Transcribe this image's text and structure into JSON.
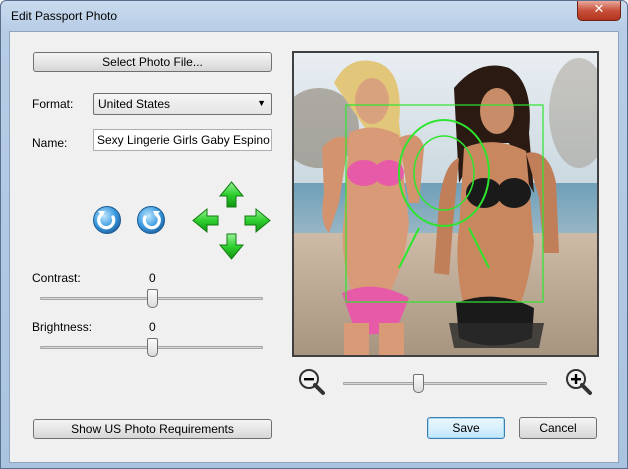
{
  "window": {
    "title": "Edit Passport Photo",
    "close_glyph": "✕"
  },
  "buttons": {
    "select_photo": "Select Photo File...",
    "show_requirements": "Show US Photo Requirements",
    "save": "Save",
    "cancel": "Cancel"
  },
  "format": {
    "label": "Format:",
    "value": "United States"
  },
  "name": {
    "label": "Name:",
    "value": "Sexy Lingerie Girls Gaby Espino &"
  },
  "icons": {
    "rotate_left": "rotate-left-icon",
    "rotate_right": "rotate-right-icon",
    "move": "move-arrows-icon",
    "zoom_out": "zoom-out-icon",
    "zoom_in": "zoom-in-icon"
  },
  "contrast": {
    "label": "Contrast:",
    "value": "0",
    "level": 0.5
  },
  "brightness": {
    "label": "Brightness:",
    "value": "0",
    "level": 0.5
  },
  "zoom": {
    "level": 0.37
  },
  "colors": {
    "arrow_green": "#22c422",
    "rotate_blue": "#2f8fd8",
    "guide_green": "#2ee52e"
  }
}
